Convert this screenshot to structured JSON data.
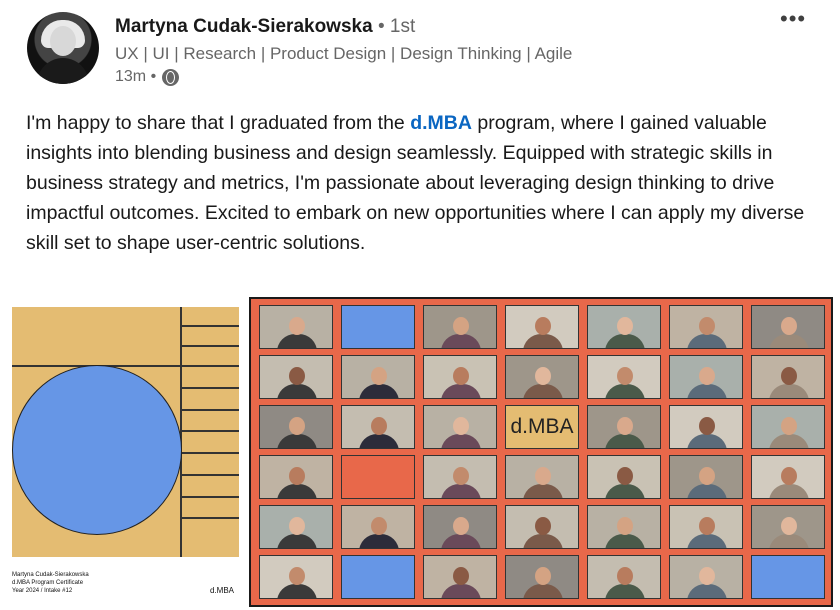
{
  "author": {
    "name": "Martyna Cudak-Sierakowska",
    "degree": "• 1st",
    "headline": "UX | UI | Research | Product Design | Design Thinking | Agile",
    "time": "13m •",
    "visibility_icon": "globe-icon"
  },
  "menu_label": "•••",
  "post": {
    "text_before": "I'm happy to share that I graduated from the ",
    "link_text": "d.MBA",
    "text_after": " program, where I gained valuable insights into blending business and design seamlessly. Equipped with strategic skills in business strategy and metrics, I'm passionate about leveraging design thinking to drive impactful outcomes. Excited to embark on new opportunities where I can apply my diverse skill set to shape user-centric solutions."
  },
  "certificate": {
    "line1": "Martyna Cudak-Sierakowska",
    "line2": "d.MBA Program Certificate",
    "line3": "Year 2024 / Intake #12",
    "logo": "d.MBA"
  },
  "grid": {
    "logo_text": "d.MBA",
    "tiles": [
      [
        "person",
        "blue",
        "person",
        "person",
        "person",
        "person",
        "person"
      ],
      [
        "person",
        "person",
        "person",
        "person",
        "person",
        "person",
        "person"
      ],
      [
        "person",
        "person",
        "person",
        "logo",
        "person",
        "person",
        "person"
      ],
      [
        "person",
        "orange",
        "person",
        "person",
        "person",
        "person",
        "person"
      ],
      [
        "person",
        "person",
        "person",
        "person",
        "person",
        "person",
        "person"
      ],
      [
        "person",
        "blue",
        "person",
        "person",
        "person",
        "person",
        "blue"
      ]
    ]
  },
  "colors": {
    "accent": "#0a66c2",
    "orange": "#e8684a",
    "blue": "#6696e6",
    "tan": "#e4bc72"
  }
}
